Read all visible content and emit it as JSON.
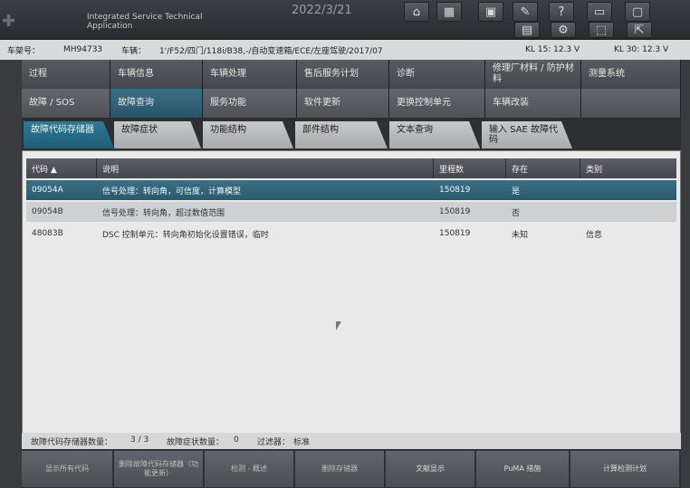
{
  "titlebar": {
    "app_name": "Integrated Service Technical Application",
    "date": "2022/3/21",
    "icons": [
      "home-icon",
      "grid-icon",
      "image-icon",
      "wrench-icon",
      "help-icon",
      "window-icon",
      "restore-icon"
    ],
    "icons2": [
      "calendar-icon",
      "gear-icon",
      "screenshot-icon",
      "export-icon"
    ],
    "icon_glyphs": [
      "⌂",
      "▦",
      "▣",
      "✎",
      "?",
      "▭",
      "▢",
      "▤",
      "⚙",
      "⬚",
      "⇱"
    ]
  },
  "infobar": {
    "vin_label": "车架号：",
    "vin": "MH94733",
    "vehicle_label": "车辆：",
    "vehicle": "1'/F52/四门/118i/B38,-/自动变速箱/ECE/左座驾驶/2017/07",
    "kl15": "KL 15:  12.3 V",
    "kl30": "KL 30:  12.3 V"
  },
  "nav_row1": [
    {
      "label": "过程",
      "active": false
    },
    {
      "label": "车辆信息",
      "active": false
    },
    {
      "label": "车辆处理",
      "active": false
    },
    {
      "label": "售后服务计划",
      "active": false
    },
    {
      "label": "诊断",
      "active": false
    },
    {
      "label": "修理厂材料 / 防护材料",
      "active": false
    },
    {
      "label": "测量系统",
      "active": false
    }
  ],
  "nav_row2": [
    {
      "label": "故障 / SOS",
      "active": false
    },
    {
      "label": "故障查询",
      "active": true
    },
    {
      "label": "服务功能",
      "active": false
    },
    {
      "label": "软件更新",
      "active": false
    },
    {
      "label": "更换控制单元",
      "active": false
    },
    {
      "label": "车辆改装",
      "active": false
    },
    {
      "label": "",
      "active": false
    }
  ],
  "tabs": [
    {
      "label": "故障代码存储器",
      "active": true
    },
    {
      "label": "故障症状",
      "active": false
    },
    {
      "label": "功能结构",
      "active": false
    },
    {
      "label": "部件结构",
      "active": false
    },
    {
      "label": "文本查询",
      "active": false
    },
    {
      "label": "输入 SAE 故障代码",
      "active": false
    }
  ],
  "table": {
    "headers": [
      "代码 ▲",
      "说明",
      "里程数",
      "存在",
      "类别"
    ],
    "rows": [
      {
        "code": "09054A",
        "desc": "信号处理：转向角，可信度，计算模型",
        "km": "150819",
        "present": "是",
        "cat": ""
      },
      {
        "code": "09054B",
        "desc": "信号处理：转向角，超过数值范围",
        "km": "150819",
        "present": "否",
        "cat": ""
      },
      {
        "code": "48083B",
        "desc": "DSC 控制单元：转向角初始化设置错误，临时",
        "km": "150819",
        "present": "未知",
        "cat": "信息"
      }
    ]
  },
  "footer": {
    "count_label": "故障代码存储器数量：",
    "count": "3 / 3",
    "symptom_label": "故障症状数量：",
    "symptom": "0",
    "filter_label": "过滤器：",
    "filter": "标准",
    "buttons": [
      "显示所有代码",
      "删除故障代码存储器（功能更新）",
      "检测 - 概述",
      "删除存储器",
      "文献显示",
      "PuMA 措施",
      "计算检测计划"
    ]
  }
}
